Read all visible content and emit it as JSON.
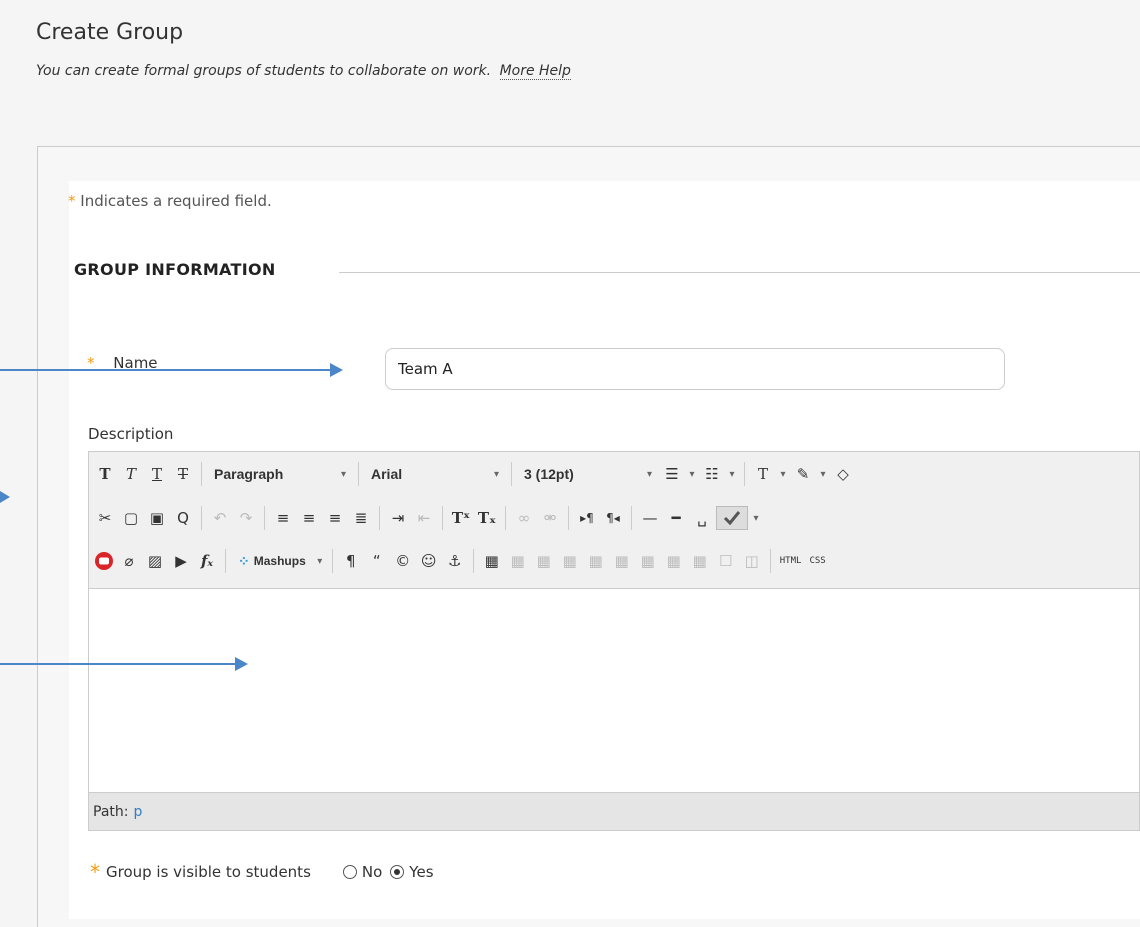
{
  "header": {
    "title": "Create Group",
    "subtitle": "You can create formal groups of students to collaborate on work.",
    "help_link": "More Help"
  },
  "form": {
    "required_note": "Indicates a required field.",
    "required_star": "*",
    "section_title": "GROUP INFORMATION",
    "name_label": "Name",
    "name_value": "Team A",
    "description_label": "Description",
    "visibility_label": "Group is visible to students",
    "visibility_options": [
      "No",
      "Yes"
    ],
    "visibility_selected": "Yes"
  },
  "editor": {
    "paragraph_format": "Paragraph",
    "font_family": "Arial",
    "font_size": "3 (12pt)",
    "mashups_label": "Mashups",
    "html_label": "HTML",
    "css_label": "CSS",
    "path_label": "Path:",
    "path_value": "p"
  },
  "colors": {
    "accent_arrow": "#4a86c8",
    "required_star": "#f39c12",
    "link": "#2f7fbf"
  }
}
